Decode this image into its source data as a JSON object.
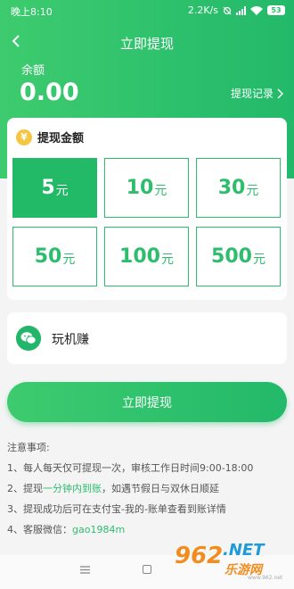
{
  "status": {
    "time": "晚上8:10",
    "speed": "2.2K/s",
    "battery": "53"
  },
  "nav": {
    "title": "立即提现"
  },
  "balance": {
    "label": "余额",
    "value": "0.00",
    "record_link": "提现记录"
  },
  "amount_card": {
    "title": "提现金额",
    "icon": "yen-coin-icon",
    "unit": "元",
    "options": [
      {
        "value": "5",
        "selected": true
      },
      {
        "value": "10",
        "selected": false
      },
      {
        "value": "30",
        "selected": false
      },
      {
        "value": "50",
        "selected": false
      },
      {
        "value": "100",
        "selected": false
      },
      {
        "value": "500",
        "selected": false
      }
    ]
  },
  "payment": {
    "icon": "wechat-icon",
    "label": "玩机赚"
  },
  "submit": {
    "label": "立即提现"
  },
  "notes": {
    "title": "注意事项:",
    "line1": "1、每人每天仅可提现一次，审核工作日时间9:00-18:00",
    "line2_prefix": "2、提现",
    "line2_highlight": "一分钟内到账",
    "line2_suffix": "，如遇节假日与双休日顺延",
    "line3": "3、提现成功后可在支付宝-我的-账单查看到账详情",
    "line4_prefix": "4、客服微信：",
    "line4_highlight": "gao1984m"
  },
  "watermark": {
    "num": "962",
    "net": ".NET",
    "cn": "乐游网",
    "url": "www.962.net"
  },
  "colors": {
    "primary": "#22b96a",
    "primary_light": "#3ecb6f",
    "coin": "#f6c643"
  }
}
